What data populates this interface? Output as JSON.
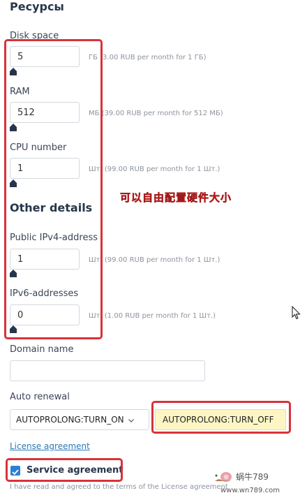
{
  "sections": {
    "resources_title": "Ресурсы",
    "other_title": "Other details"
  },
  "fields": [
    {
      "label": "Disk space",
      "value": "5",
      "note": "ГБ (3.00 RUB per month for 1 ГБ)"
    },
    {
      "label": "RAM",
      "value": "512",
      "note": "МБ (39.00 RUB per month for 512 МБ)"
    },
    {
      "label": "CPU number",
      "value": "1",
      "note": "Шт. (99.00 RUB per month for 1 Шт.)"
    },
    {
      "label": "Public IPv4-address",
      "value": "1",
      "note": "Шт. (99.00 RUB per month for 1 Шт.)"
    },
    {
      "label": "IPv6-addresses",
      "value": "0",
      "note": "Шт. (1.00 RUB per month for 1 Шт.)"
    }
  ],
  "domain": {
    "label": "Domain name",
    "value": ""
  },
  "auto_renewal": {
    "label": "Auto renewal",
    "selected": "AUTOPROLONG:TURN_ON",
    "highlighted_option": "AUTOPROLONG:TURN_OFF"
  },
  "license_link": "License agreement",
  "service_agreement": {
    "label": "Service agreement",
    "checked": true,
    "terms": "I have read and agreed to the terms of the License agreement"
  },
  "annotation": "可以自由配置硬件大小",
  "watermark": "蜗牛789",
  "watermark_url": "www.wn789.com",
  "colors": {
    "accent": "#2d7fd1",
    "annotation_red": "#d8323a",
    "highlight": "#fdf6c4"
  }
}
